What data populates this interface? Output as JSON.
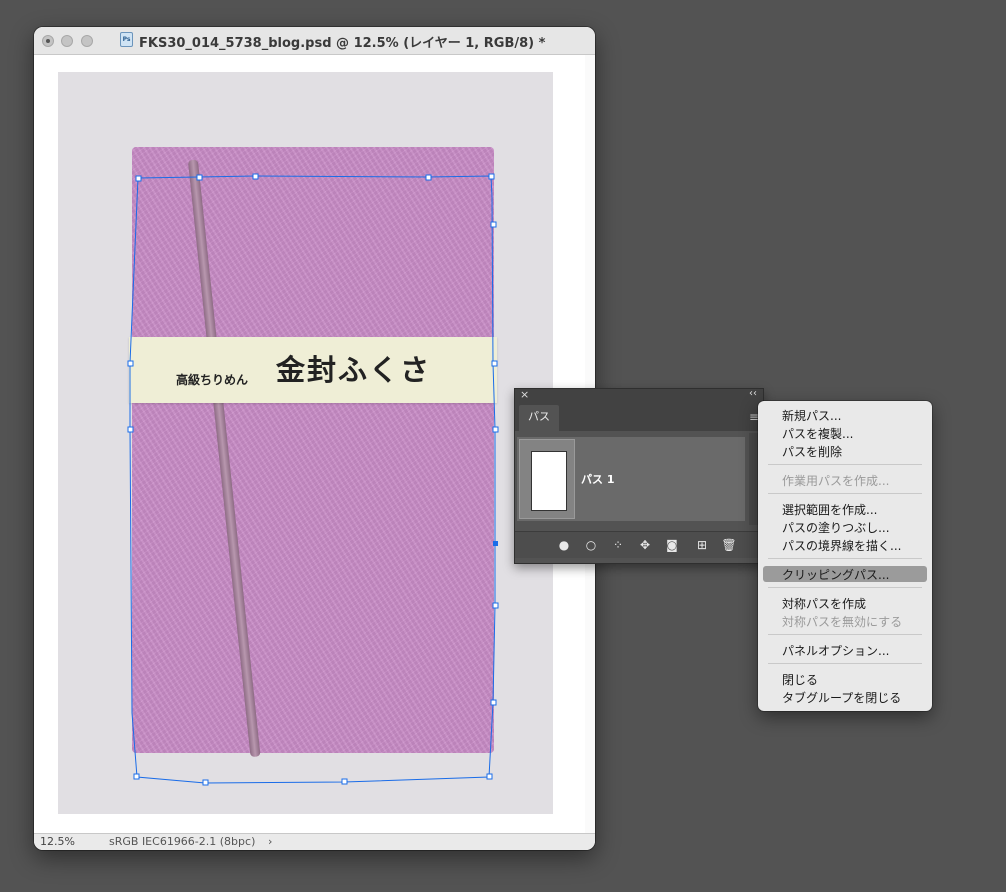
{
  "document": {
    "title": "FKS30_014_5738_blog.psd @ 12.5% (レイヤー 1, RGB/8) *",
    "icon_label": "Ps",
    "icon": "photoshop-doc-icon"
  },
  "image": {
    "band_small_text": "高級ちりめん",
    "band_large_text": "金封ふくさ"
  },
  "status": {
    "zoom": "12.5%",
    "color_profile": "sRGB IEC61966-2.1 (8bpc)",
    "arrow": "›"
  },
  "paths_panel": {
    "tab_label": "パス",
    "close_glyph": "×",
    "collapse_glyph": "‹‹",
    "menu_glyph": "≡",
    "paths": [
      {
        "name": "パス 1"
      }
    ],
    "bottom_icons": [
      "fill-path-icon",
      "stroke-path-icon",
      "load-selection-icon",
      "make-work-path-icon",
      "add-mask-icon",
      "new-path-icon",
      "trash-icon"
    ]
  },
  "context_menu": {
    "items": [
      {
        "label": "新規パス...",
        "enabled": true
      },
      {
        "label": "パスを複製...",
        "enabled": true
      },
      {
        "label": "パスを削除",
        "enabled": true
      },
      {
        "label": "作業用パスを作成...",
        "enabled": false
      },
      {
        "label": "選択範囲を作成...",
        "enabled": true
      },
      {
        "label": "パスの塗りつぶし...",
        "enabled": true
      },
      {
        "label": "パスの境界線を描く...",
        "enabled": true
      },
      {
        "label": "クリッピングパス...",
        "enabled": true,
        "highlighted": true
      },
      {
        "label": "対称パスを作成",
        "enabled": true
      },
      {
        "label": "対称パスを無効にする",
        "enabled": false
      },
      {
        "label": "パネルオプション...",
        "enabled": true
      },
      {
        "label": "閉じる",
        "enabled": true
      },
      {
        "label": "タブグループを閉じる",
        "enabled": true
      }
    ]
  },
  "colors": {
    "workspace_bg": "#535353",
    "envelope": "#c98cc7",
    "path_stroke": "#1a6ce8",
    "menu_highlight": "#9b9b9b"
  }
}
